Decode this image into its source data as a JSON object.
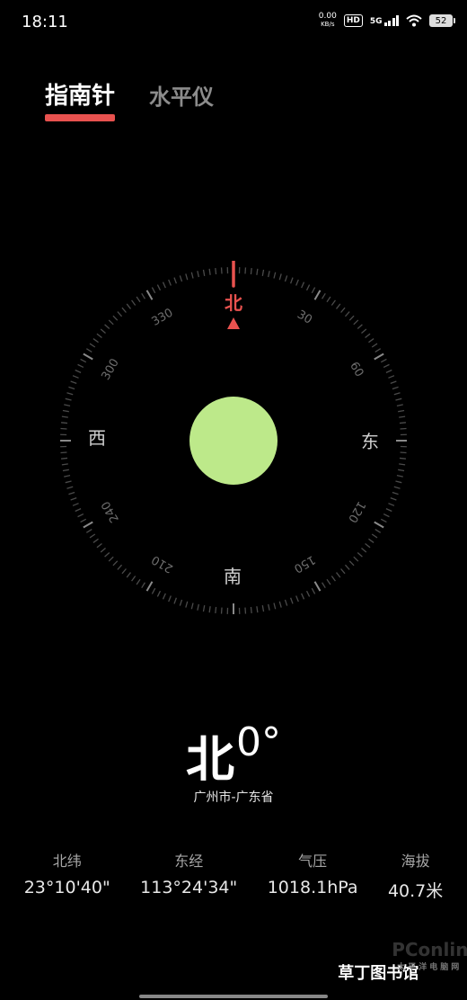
{
  "status": {
    "time": "18:11",
    "speed": "0.00",
    "speed_unit": "KB/s",
    "hd": "HD",
    "network": "5G",
    "battery": "52"
  },
  "tabs": [
    {
      "label": "指南针"
    },
    {
      "label": "水平仪"
    }
  ],
  "compass": {
    "cardinals": {
      "north": "北",
      "east": "东",
      "south": "南",
      "west": "西"
    },
    "degree_labels": [
      "30",
      "60",
      "120",
      "150",
      "210",
      "240",
      "300",
      "330"
    ],
    "north_color": "#e8524f",
    "bubble_color": "#bde98a"
  },
  "heading": {
    "direction": "北",
    "degrees": "0°"
  },
  "location": "广州市-广东省",
  "stats": [
    {
      "label": "北纬",
      "value": "23°10'40\""
    },
    {
      "label": "东经",
      "value": "113°24'34\""
    },
    {
      "label": "气压",
      "value": "1018.1hPa"
    },
    {
      "label": "海拔",
      "value": "40.7米"
    }
  ],
  "watermark": {
    "main": "PConline",
    "brand": "草丁图书馆",
    "sub": "太平洋电脑网"
  }
}
